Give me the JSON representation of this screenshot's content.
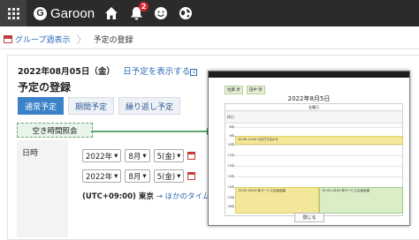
{
  "topbar": {
    "app_name": "Garoon",
    "logo_letter": "G",
    "notification_count": "2",
    "icons": [
      "apps-grid-icon",
      "home-icon",
      "bell-icon",
      "smiley-icon",
      "globe-icon"
    ]
  },
  "breadcrumb": {
    "link": "グループ週表示",
    "current": "予定の登録"
  },
  "main": {
    "date": "2022年08月05日（金）",
    "date_link": "日予定を表示する",
    "title": "予定の登録",
    "tabs": [
      {
        "label": "通常予定",
        "active": true
      },
      {
        "label": "期間予定",
        "active": false
      },
      {
        "label": "繰り返し予定",
        "active": false
      }
    ],
    "availability_button": "空き時間照会",
    "datetime_label": "日時",
    "rows": [
      {
        "year": "2022年",
        "month": "8月",
        "day": "5(金)"
      },
      {
        "year": "2022年",
        "month": "8月",
        "day": "5(金)"
      }
    ],
    "timezone": "(UTC+09:00) 東京",
    "timezone_link": "→ ほかのタイムゾー"
  },
  "popup": {
    "chips": [
      "佐藤 昇",
      "田中 柴"
    ],
    "date": "2022年8月5日",
    "column_header": "金曜日",
    "allday_label": "終日",
    "close_label": "閉じる",
    "times": [
      "8時",
      "9時",
      "10時",
      "11時",
      "12時",
      "13時",
      "14時",
      "15時",
      "16時",
      "17時"
    ],
    "events": [
      {
        "text": "10:00-12:00 A社打ち合わせ",
        "color": "#f3e79a"
      },
      {
        "text": "15:00-18:00 新サービス企画会議",
        "color": "#f3e79a"
      },
      {
        "text": "15:00-18:00 新サービス企画会議",
        "color": "#d9edc6"
      }
    ]
  },
  "colors": {
    "topbar": "#2b2b2b",
    "accent": "#3c82c9",
    "link": "#2c6bb5",
    "badge": "#d9232d"
  }
}
